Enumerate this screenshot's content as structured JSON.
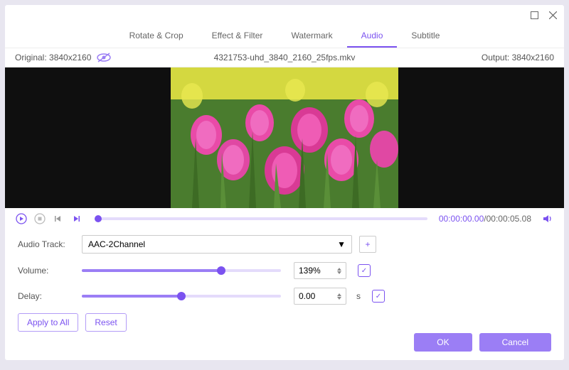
{
  "titlebar": {},
  "tabs": [
    "Rotate & Crop",
    "Effect & Filter",
    "Watermark",
    "Audio",
    "Subtitle"
  ],
  "active_tab": "Audio",
  "infobar": {
    "original_label": "Original: 3840x2160",
    "filename": "4321753-uhd_3840_2160_25fps.mkv",
    "output_label": "Output: 3840x2160"
  },
  "playback": {
    "current": "00:00:00.00",
    "sep": "/",
    "total": "00:00:05.08"
  },
  "form": {
    "audio_track_label": "Audio Track:",
    "audio_track_value": "AAC-2Channel",
    "volume_label": "Volume:",
    "volume_value": "139%",
    "volume_fill": 70,
    "delay_label": "Delay:",
    "delay_value": "0.00",
    "delay_unit": "s",
    "delay_fill": 50
  },
  "buttons": {
    "apply_all": "Apply to All",
    "reset": "Reset",
    "ok": "OK",
    "cancel": "Cancel"
  }
}
